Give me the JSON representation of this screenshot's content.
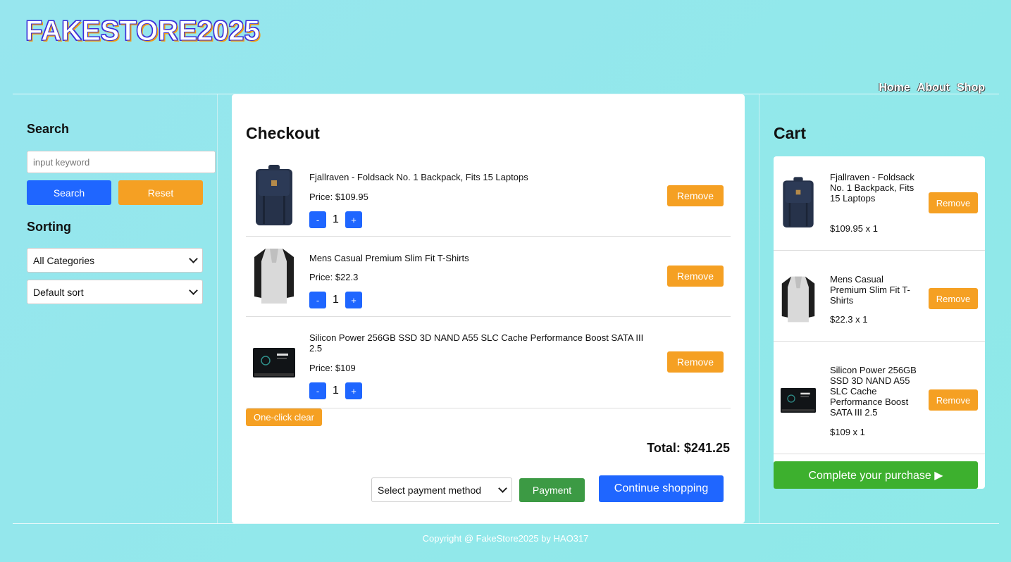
{
  "brand": {
    "logo": "FAKESTORE2025"
  },
  "nav": [
    "Home",
    "About",
    "Shop"
  ],
  "search": {
    "title": "Search",
    "placeholder": "input keyword",
    "search_label": "Search",
    "reset_label": "Reset"
  },
  "sorting": {
    "title": "Sorting",
    "category_selected": "All Categories",
    "sort_selected": "Default sort"
  },
  "checkout": {
    "title": "Checkout",
    "items": [
      {
        "title": "Fjallraven - Foldsack No. 1 Backpack, Fits 15 Laptops",
        "price": "Price: $109.95",
        "qty": "1",
        "minus": "-",
        "plus": "+",
        "remove": "Remove",
        "icon": "backpack-image"
      },
      {
        "title": "Mens Casual Premium Slim Fit T-Shirts",
        "price": "Price: $22.3",
        "qty": "1",
        "minus": "-",
        "plus": "+",
        "remove": "Remove",
        "icon": "tshirt-image"
      },
      {
        "title": "Silicon Power 256GB SSD 3D NAND A55 SLC Cache Performance Boost SATA III 2.5",
        "price": "Price: $109",
        "qty": "1",
        "minus": "-",
        "plus": "+",
        "remove": "Remove",
        "icon": "ssd-image"
      }
    ],
    "clear_label": "One-click clear",
    "total": "Total: $241.25",
    "payment_placeholder": "Select payment method",
    "payment_label": "Payment",
    "continue_label": "Continue shopping"
  },
  "cart": {
    "title": "Cart",
    "items": [
      {
        "title": "Fjallraven - Foldsack No. 1 Backpack, Fits 15 Laptops",
        "qty": "$109.95 x 1",
        "remove": "Remove"
      },
      {
        "title": "Mens Casual Premium Slim Fit T-Shirts",
        "qty": "$22.3 x 1",
        "remove": "Remove"
      },
      {
        "title": "Silicon Power 256GB SSD 3D NAND A55 SLC Cache Performance Boost SATA III 2.5",
        "qty": "$109 x 1",
        "remove": "Remove"
      }
    ],
    "complete_label": "Complete your purchase ▶"
  },
  "footer": "Copyright @ FakeStore2025 by HAO317",
  "colors": {
    "background": "#8ee9e8",
    "primary_blue": "#1f66ff",
    "orange": "#f5a023",
    "payment_green": "#3c9a44",
    "complete_green": "#3db02e"
  }
}
